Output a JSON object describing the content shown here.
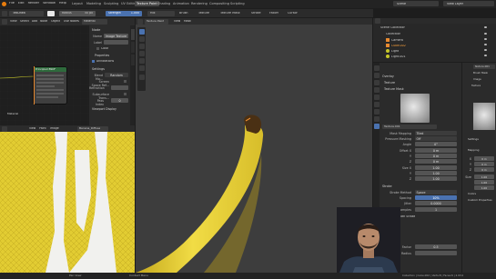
{
  "colors": {
    "bg": "#1d1d1d",
    "header": "#2b2b2b",
    "panel": "#303030",
    "accent": "#4a72b0",
    "banana": "#e8d23a",
    "banana_shade": "#c4a81d",
    "stem": "#4a3014",
    "viewport": "#3d3d3d",
    "uv_bg": "#303030",
    "orange": "#e88a30"
  },
  "top_menu": [
    "File",
    "Edit",
    "Render",
    "Window",
    "Help"
  ],
  "workspace_tabs": [
    "Layout",
    "Modeling",
    "Sculpting",
    "UV Editing",
    "Texture Paint",
    "Shading",
    "Animation",
    "Rendering",
    "Compositing",
    "Scripting"
  ],
  "active_tab": "Texture Paint",
  "scene_label": "Scene",
  "view_layer_label": "View Layer",
  "tool_header": {
    "brush_name": "TexDraw",
    "radius_label": "Radius",
    "radius_value": "50 px",
    "strength_label": "Strength",
    "strength_value": "1.000",
    "blend_label": "Mix",
    "brush_menu": "Brush",
    "texture_menu": "Texture",
    "texture_mask_menu": "Texture Mask",
    "stroke_menu": "Stroke",
    "falloff_menu": "Falloff",
    "cursor_menu": "Cursor"
  },
  "shader_editor": {
    "menus": [
      "View",
      "Select",
      "Add",
      "Node"
    ],
    "object_label": "Object",
    "slot_label": "Use Nodes",
    "material_name": "Material",
    "node_title": "Principled BSDF",
    "node_footer": "Material",
    "sidepanel": {
      "node_section": "Node",
      "name_label": "Name",
      "name_value": "Image Texture",
      "label_label": "Label",
      "color_label": "Color",
      "properties_label": "Properties",
      "annotations_label": "Annotations",
      "settings_label": "Settings",
      "blend_label": "Blend Mo...",
      "blend_value": "Random",
      "screen_space_label": "Screen Space Ref...",
      "refraction_label": "Refraction",
      "subsurface_label": "Subsurface Trans...",
      "max_index_label": "Pass Index",
      "max_index_value": "0",
      "viewport_display": "Viewport Display"
    }
  },
  "viewport": {
    "menus": [
      "Texture Paint",
      "View",
      "Mask"
    ],
    "object_mode": "Texture Paint"
  },
  "uv_editor": {
    "menus": [
      "View",
      "Paint",
      "Image"
    ],
    "image_name": "Banana_Diffuse"
  },
  "outliner": {
    "title": "Scene Collection",
    "items": [
      {
        "name": "Collection",
        "indent": 1
      },
      {
        "name": "Camera",
        "indent": 2
      },
      {
        "name": "Cube.002",
        "indent": 2
      },
      {
        "name": "Light",
        "indent": 2
      },
      {
        "name": "Light.001",
        "indent": 2
      }
    ]
  },
  "properties": {
    "display_label": "Overlay",
    "texture_label": "Texture",
    "texture_mask_label": "Texture Mask",
    "texture_name": "Texture.001",
    "mask_mapping_label": "Mask Mapping",
    "mask_mapping_value": "Tiled",
    "pressure_label": "Pressure Masking",
    "pressure_value": "Off",
    "angle_label": "Angle",
    "angle_value": "0°",
    "offset_x_label": "Offset X",
    "offset_x_value": "0 m",
    "offset_y_label": "Y",
    "offset_y_value": "0 m",
    "offset_z_label": "Z",
    "offset_z_value": "0 m",
    "size_x_label": "Size X",
    "size_x_value": "1.00",
    "size_y_label": "Y",
    "size_y_value": "1.00",
    "size_z_label": "Z",
    "size_z_value": "1.00",
    "stroke_label": "Stroke",
    "stroke_method_label": "Stroke Method",
    "stroke_method_value": "Space",
    "spacing_label": "Spacing",
    "spacing_value": "10%",
    "jitter_label": "Jitter",
    "jitter_value": "0.0000",
    "input_samples_label": "Input Samples",
    "input_samples_value": "1",
    "smooth_stroke_label": "Smooth Stroke",
    "radius_label": "Radius",
    "factor_label": "Factor",
    "factor_value": "0.5"
  },
  "right_panel": {
    "texture_name": "Texture.001",
    "brush_mask": "Brush Mask",
    "image_label": "Image",
    "texture_label": "Texture",
    "settings_label": "Settings",
    "mapping_label": "Mapping",
    "offset_label": "Offset",
    "x_label": "X",
    "y_label": "Y",
    "z_label": "Z",
    "x_val": "0 m",
    "y_val": "0 m",
    "z_val": "0 m",
    "size_label": "Size",
    "size_x": "1.00",
    "size_y": "1.00",
    "size_z": "1.00",
    "colors_label": "Colors",
    "custom_props_label": "Custom Properties"
  },
  "status_bar": {
    "left": "Pan View",
    "mid": "Context Menu",
    "right": "Collection | Cube.002 | Verts:8 | Faces:6 | 2.93.0"
  }
}
